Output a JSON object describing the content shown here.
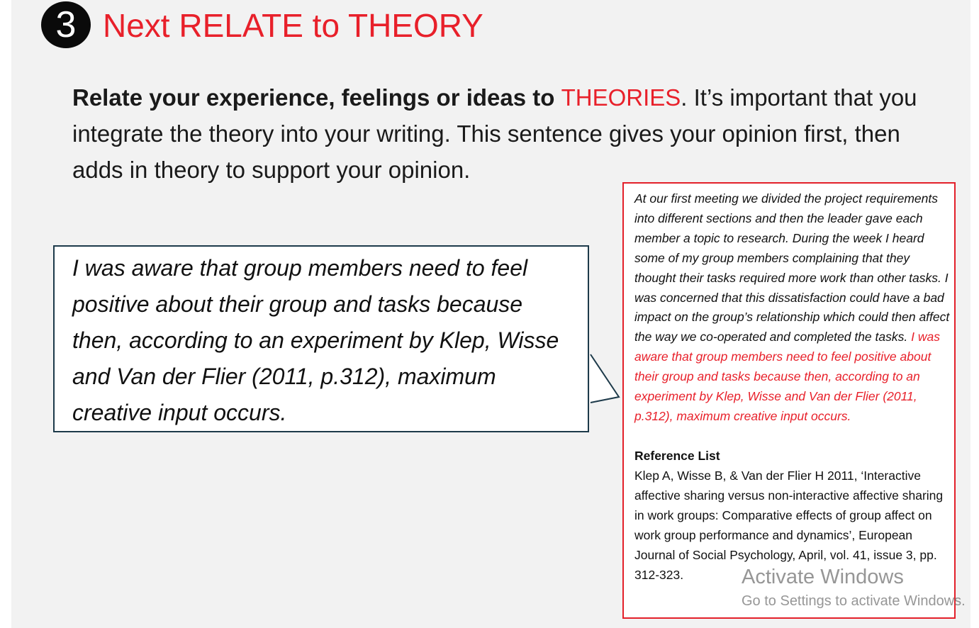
{
  "step": {
    "number": "3",
    "title": "Next RELATE to THEORY"
  },
  "intro": {
    "bold_lead": "Relate your experience, feelings or ideas to ",
    "accent_word": "THEORIES",
    "rest": ". It’s important that you integrate the theory into your writing. This sentence gives your opinion first, then adds in theory to support your opinion."
  },
  "callout": {
    "text": "I was aware that group members need to feel positive about their group and tasks because then, according to an experiment by Klep, Wisse and Van der Flier (2011, p.312), maximum creative input occurs."
  },
  "example": {
    "body": "At our first meeting we divided the project requirements into different sections and then the leader gave each member a topic to research. During the week I heard some of my group members complaining that they thought their tasks required more work than other tasks. I was concerned that this dissatisfaction could have a bad impact on the group’s relationship which could then affect the way we co-operated and completed the tasks. ",
    "highlight": "I was aware that group members need to feel positive about their group and tasks because then, according to an experiment by Klep, Wisse and Van der Flier (2011, p.312), maximum creative input occurs.",
    "reference_heading": "Reference List",
    "reference_text": "Klep A, Wisse B, & Van der Flier H 2011, ‘Interactive affective sharing versus non-interactive affective sharing in work groups: Comparative effects of group affect on work group performance and dynamics’, European Journal of Social Psychology, April, vol. 41, issue 3, pp. 312-323."
  },
  "watermark": {
    "title": "Activate Windows",
    "subtitle": "Go to Settings to activate Windows."
  },
  "colors": {
    "accent": "#e8202a",
    "slide_background": "#f2f2f2",
    "callout_border": "#1d3a4a",
    "example_border": "#e3202a"
  }
}
